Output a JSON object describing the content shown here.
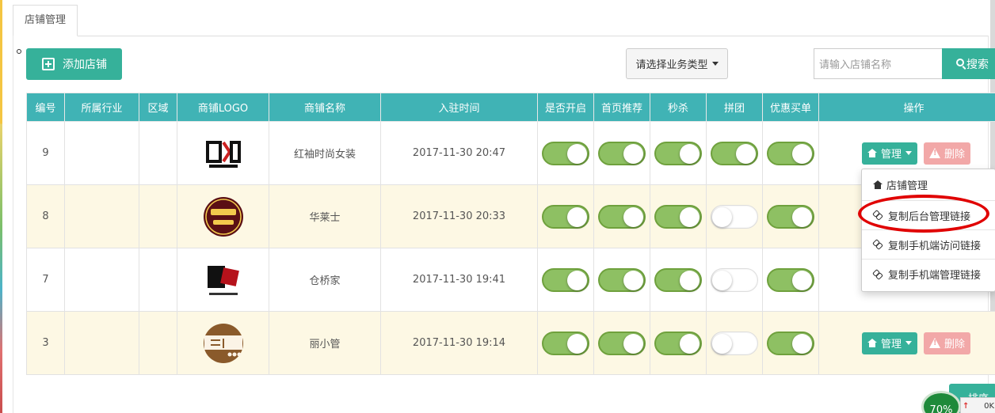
{
  "tabs": [
    {
      "label": "店铺管理"
    }
  ],
  "toolbar": {
    "add_label": "添加店铺",
    "business_type_label": "请选择业务类型",
    "search_placeholder": "请输入店铺名称",
    "search_label": "搜索"
  },
  "table": {
    "headers": [
      "编号",
      "所属行业",
      "区域",
      "商铺LOGO",
      "商铺名称",
      "入驻时间",
      "是否开启",
      "首页推荐",
      "秒杀",
      "拼团",
      "优惠买单",
      "操作"
    ],
    "rows": [
      {
        "id": "9",
        "industry": "",
        "region": "",
        "name": "红袖时尚女装",
        "time": "2017-11-30 20:47",
        "open": true,
        "home": true,
        "flash": true,
        "group": true,
        "discount": true
      },
      {
        "id": "8",
        "industry": "",
        "region": "",
        "name": "华莱士",
        "time": "2017-11-30 20:33",
        "open": true,
        "home": true,
        "flash": true,
        "group": false,
        "discount": true
      },
      {
        "id": "7",
        "industry": "",
        "region": "",
        "name": "仓桥家",
        "time": "2017-11-30 19:41",
        "open": true,
        "home": true,
        "flash": true,
        "group": false,
        "discount": true
      },
      {
        "id": "3",
        "industry": "",
        "region": "",
        "name": "丽小管",
        "time": "2017-11-30 19:14",
        "open": true,
        "home": true,
        "flash": true,
        "group": false,
        "discount": true
      }
    ],
    "manage_label": "管理",
    "delete_label": "删除"
  },
  "dropdown": {
    "items": [
      "店铺管理",
      "复制后台管理链接",
      "复制手机端访问链接",
      "复制手机端管理链接"
    ]
  },
  "footer": {
    "sort_label": "排序",
    "speed_percent": "70%",
    "net_speed": "0K"
  },
  "colors": {
    "primary": "#36b19a",
    "header": "#40b3b5",
    "toggle_on": "#8ec063",
    "delete": "#f2a8a8",
    "highlight": "#e00000"
  }
}
